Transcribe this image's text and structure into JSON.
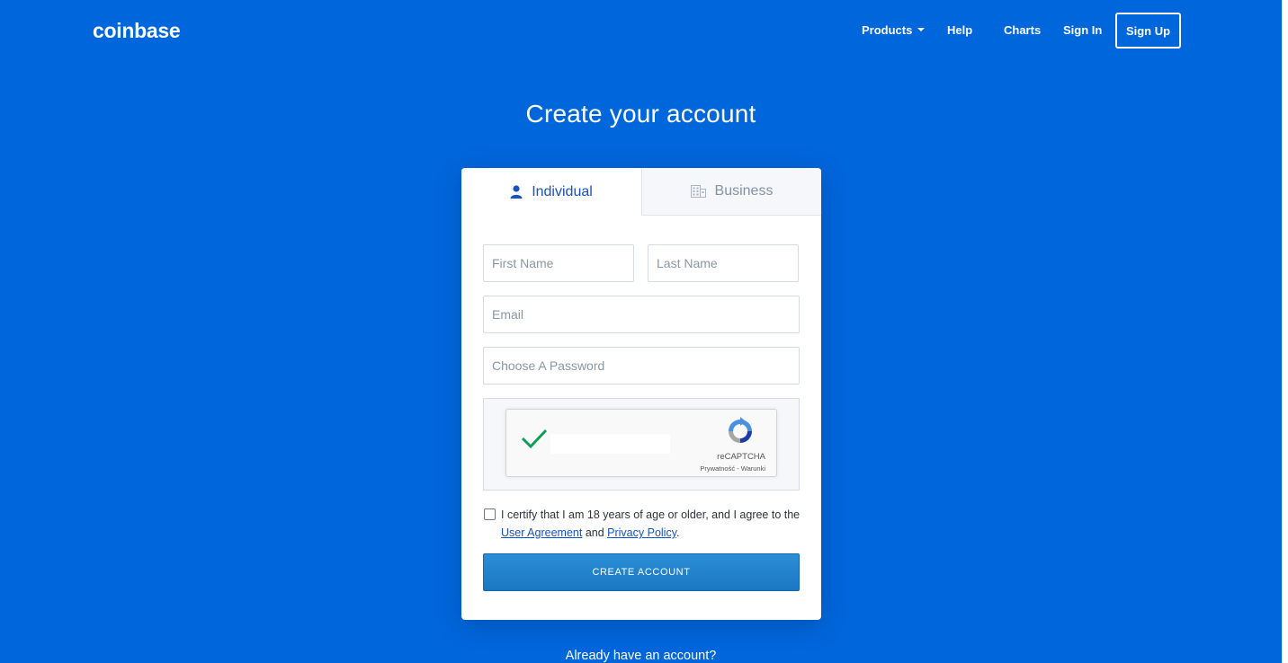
{
  "header": {
    "logo": "coinbase",
    "nav": {
      "products": "Products",
      "help": "Help",
      "charts": "Charts",
      "sign_in": "Sign In",
      "sign_up": "Sign Up"
    }
  },
  "page_title": "Create your account",
  "tabs": {
    "individual": "Individual",
    "business": "Business",
    "active": "Individual"
  },
  "form": {
    "first_name_placeholder": "First Name",
    "last_name_placeholder": "Last Name",
    "email_placeholder": "Email",
    "password_placeholder": "Choose A Password",
    "captcha": {
      "brand": "reCAPTCHA",
      "links": "Prywatność - Warunki",
      "checked": true
    },
    "certify": {
      "text": "I certify that I am 18 years of age or older, and I agree to the",
      "user_agreement": "User Agreement",
      "and": "and",
      "privacy_policy": "Privacy Policy",
      "period": ".",
      "checked": false
    },
    "submit_label": "CREATE ACCOUNT"
  },
  "footer": {
    "already": "Already have an account?"
  },
  "colors": {
    "background": "#0066dc",
    "accent": "#1652c4",
    "button": "#1a78c2",
    "check": "#0f9d58"
  },
  "icons": {
    "individual": "user-icon",
    "business": "building-icon",
    "products": "caret-down-icon",
    "captcha_check": "checkmark-icon",
    "captcha_logo": "recaptcha-icon"
  }
}
